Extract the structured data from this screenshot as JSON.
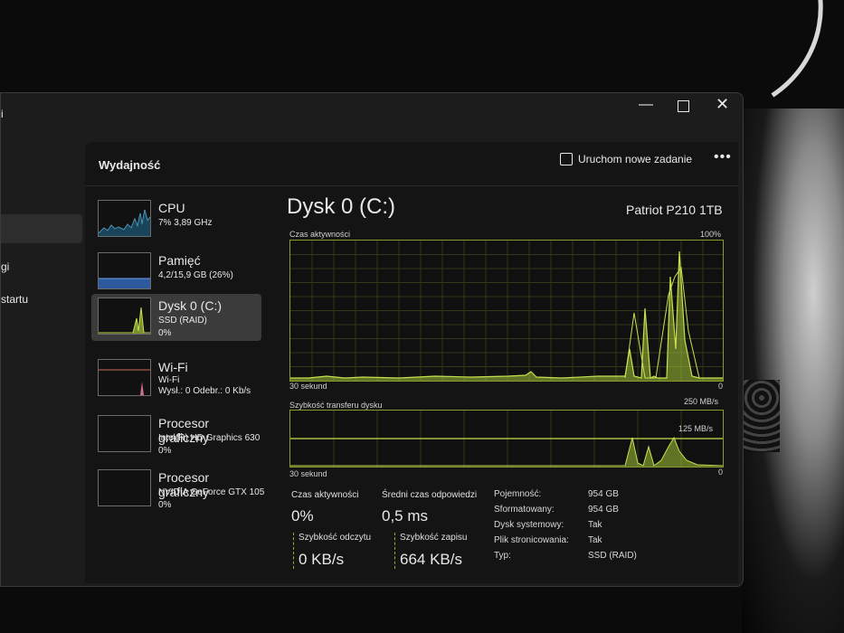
{
  "window": {
    "minimize_icon": "minimize-icon",
    "maximize_icon": "maximize-icon",
    "close_icon": "close-icon"
  },
  "left_nav": {
    "items": [
      "i",
      "gi",
      "startu"
    ]
  },
  "header": {
    "title": "Wydajność",
    "run_task_label": "Uruchom nowe zadanie",
    "more_icon": "more-icon"
  },
  "sidebar": {
    "items": [
      {
        "name": "CPU",
        "line1": "7%  3,89 GHz",
        "line2": "",
        "selected": false
      },
      {
        "name": "Pamięć",
        "line1": "4,2/15,9 GB (26%)",
        "line2": "",
        "selected": false
      },
      {
        "name": "Dysk 0 (C:)",
        "line1": "SSD (RAID)",
        "line2": "0%",
        "selected": true
      },
      {
        "name": "Wi-Fi",
        "line1": "Wi-Fi",
        "line2": "Wysł.: 0 Odebr.: 0 Kb/s",
        "selected": false
      },
      {
        "name": "Procesor graficzny",
        "line1": "Intel(R) HD Graphics 630",
        "line2": "0%",
        "selected": false
      },
      {
        "name": "Procesor graficzny",
        "line1": "NVIDIA GeForce GTX 105",
        "line2": "0%",
        "selected": false
      }
    ]
  },
  "detail": {
    "title": "Dysk 0 (C:)",
    "model": "Patriot P210 1TB",
    "graph1": {
      "label": "Czas aktywności",
      "max": "100%",
      "min": "0",
      "time": "30 sekund"
    },
    "graph2": {
      "label": "Szybkość transferu dysku",
      "max": "250 MB/s",
      "mid": "125 MB/s",
      "min": "0",
      "time": "30 sekund"
    },
    "stats": {
      "active_time_label": "Czas aktywności",
      "active_time_value": "0%",
      "avg_response_label": "Średni czas odpowiedzi",
      "avg_response_value": "0,5 ms",
      "read_speed_label": "Szybkość odczytu",
      "read_speed_value": "0 KB/s",
      "write_speed_label": "Szybkość zapisu",
      "write_speed_value": "664 KB/s"
    },
    "properties": [
      {
        "label": "Pojemność:",
        "value": "954 GB"
      },
      {
        "label": "Sformatowany:",
        "value": "954 GB"
      },
      {
        "label": "Dysk systemowy:",
        "value": "Tak"
      },
      {
        "label": "Plik stronicowania:",
        "value": "Tak"
      },
      {
        "label": "Typ:",
        "value": "SSD (RAID)"
      }
    ]
  },
  "colors": {
    "accent": "#a4c639",
    "window_bg": "#1c1c1c",
    "panel_bg": "#141414"
  }
}
